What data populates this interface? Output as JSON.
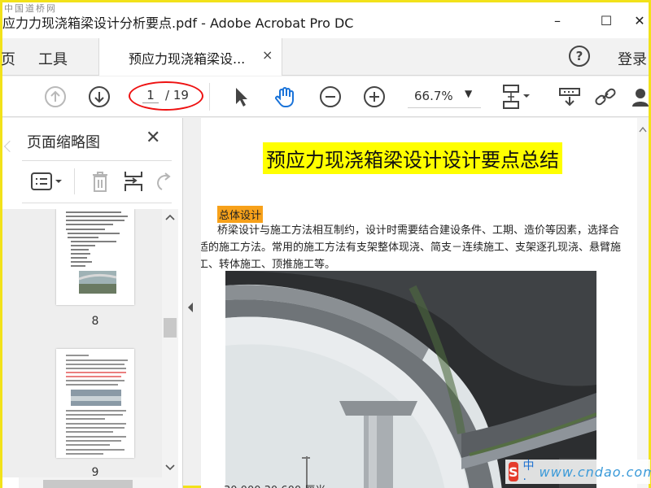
{
  "window": {
    "watermark": "中国道桥网",
    "title": "应力力现浇箱梁设计分析要点.pdf - Adobe Acrobat Pro DC",
    "min_glyph": "–",
    "max_glyph": "☐",
    "close_glyph": "✕"
  },
  "tabs": {
    "home_partial": "页",
    "tools": "工具",
    "document": "预应力现浇箱梁设...",
    "close_glyph": "×",
    "help_glyph": "?",
    "signin": "登录"
  },
  "toolbar": {
    "current_page": "1",
    "total_pages": "/ 19",
    "zoom": "66.7%",
    "zoom_arrow": "▼",
    "annotation_color": "#e11111"
  },
  "left_panel": {
    "title": "页面缩略图",
    "close_glyph": "✕",
    "thumb_pages": [
      "8",
      "9"
    ]
  },
  "document": {
    "title": "预应力现浇箱梁设计设计要点总结",
    "section": "总体设计",
    "paragraph_lines": [
      "桥梁设计与施工方法相互制约，设计时需要结合建设条件、工期、造价等因素，选择合",
      "适的施工方法。常用的施工方法有支架整体现浇、简支－连续施工、支架逐孔现浇、悬臂施",
      "工、转体施工、顶推施工等。"
    ],
    "bottom_text": "30.000  30.600  厘米",
    "title_highlight": "#ffff00",
    "section_highlight": "#f7a11a"
  },
  "ime": {
    "logo": "S",
    "mode": "中·",
    "watermark": "www.cndao.com"
  }
}
